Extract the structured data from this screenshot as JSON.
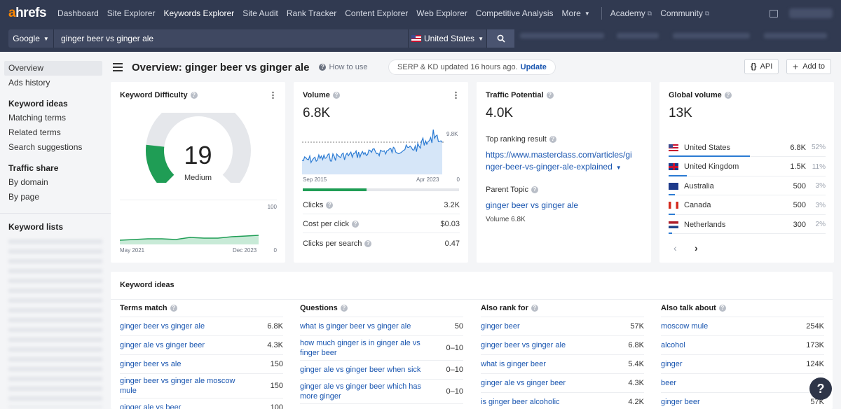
{
  "nav": {
    "logo_a": "a",
    "logo_rest": "hrefs",
    "items": [
      "Dashboard",
      "Site Explorer",
      "Keywords Explorer",
      "Site Audit",
      "Rank Tracker",
      "Content Explorer",
      "Web Explorer",
      "Competitive Analysis",
      "More"
    ],
    "academy": "Academy",
    "community": "Community"
  },
  "search": {
    "engine": "Google",
    "query": "ginger beer vs ginger ale",
    "country": "United States"
  },
  "sidebar": {
    "overview": "Overview",
    "ads_history": "Ads history",
    "keyword_ideas": "Keyword ideas",
    "matching_terms": "Matching terms",
    "related_terms": "Related terms",
    "search_suggestions": "Search suggestions",
    "traffic_share": "Traffic share",
    "by_domain": "By domain",
    "by_page": "By page",
    "keyword_lists": "Keyword lists"
  },
  "header": {
    "title": "Overview: ginger beer vs ginger ale",
    "how_to": "How to use",
    "serp_status": "SERP & KD updated 16 hours ago.",
    "update": "Update",
    "api": "API",
    "add_to": "Add to"
  },
  "kd": {
    "title": "Keyword Difficulty",
    "value": 19,
    "value_text": "19",
    "label": "Medium",
    "chart_max": "100",
    "chart_min": "0",
    "start": "May 2021",
    "end": "Dec 2023"
  },
  "volume": {
    "title": "Volume",
    "value": "6.8K",
    "peak": "9.8K",
    "zero": "0",
    "start": "Sep 2015",
    "end": "Apr 2023",
    "clicks_label": "Clicks",
    "clicks": "3.2K",
    "cpc_label": "Cost per click",
    "cpc": "$0.03",
    "cps_label": "Clicks per search",
    "cps": "0.47"
  },
  "traffic": {
    "title": "Traffic Potential",
    "value": "4.0K",
    "top_label": "Top ranking result",
    "url_line1": "https://www.masterclass.com/articles/gi",
    "url_line2": "nger-beer-vs-ginger-ale-explained",
    "parent_label": "Parent Topic",
    "parent": "ginger beer vs ginger ale",
    "parent_volume": "Volume 6.8K"
  },
  "global": {
    "title": "Global volume",
    "value": "13K",
    "countries": [
      {
        "name": "United States",
        "value": "6.8K",
        "pct": "52%",
        "flag": "flag-us"
      },
      {
        "name": "United Kingdom",
        "value": "1.5K",
        "pct": "11%",
        "flag": "flag-uk"
      },
      {
        "name": "Australia",
        "value": "500",
        "pct": "3%",
        "flag": "flag-au"
      },
      {
        "name": "Canada",
        "value": "500",
        "pct": "3%",
        "flag": "flag-ca"
      },
      {
        "name": "Netherlands",
        "value": "300",
        "pct": "2%",
        "flag": "flag-nl"
      }
    ]
  },
  "ideas": {
    "title": "Keyword ideas",
    "columns": [
      {
        "head": "Terms match",
        "rows": [
          {
            "t": "ginger beer vs ginger ale",
            "v": "6.8K"
          },
          {
            "t": "ginger ale vs ginger beer",
            "v": "4.3K"
          },
          {
            "t": "ginger beer vs ale",
            "v": "150"
          },
          {
            "t": "ginger beer vs ginger ale moscow mule",
            "v": "150"
          },
          {
            "t": "ginger ale vs beer",
            "v": "100"
          }
        ]
      },
      {
        "head": "Questions",
        "rows": [
          {
            "t": "what is ginger beer vs ginger ale",
            "v": "50"
          },
          {
            "t": "how much ginger is in ginger ale vs finger beer",
            "v": "0–10"
          },
          {
            "t": "ginger ale vs ginger beer when sick",
            "v": "0–10"
          },
          {
            "t": "ginger ale vs ginger beer which has more ginger",
            "v": "0–10"
          }
        ]
      },
      {
        "head": "Also rank for",
        "rows": [
          {
            "t": "ginger beer",
            "v": "57K"
          },
          {
            "t": "ginger beer vs ginger ale",
            "v": "6.8K"
          },
          {
            "t": "what is ginger beer",
            "v": "5.4K"
          },
          {
            "t": "ginger ale vs ginger beer",
            "v": "4.3K"
          },
          {
            "t": "is ginger beer alcoholic",
            "v": "4.2K"
          }
        ]
      },
      {
        "head": "Also talk about",
        "rows": [
          {
            "t": "moscow mule",
            "v": "254K"
          },
          {
            "t": "alcohol",
            "v": "173K"
          },
          {
            "t": "ginger",
            "v": "124K"
          },
          {
            "t": "beer",
            "v": ""
          },
          {
            "t": "ginger beer",
            "v": "57K"
          }
        ]
      }
    ]
  },
  "help": "?",
  "colors": {
    "nav_bg": "#313a51",
    "link": "#1a56b0",
    "accent": "#ff8800",
    "green": "#1f9d55"
  }
}
